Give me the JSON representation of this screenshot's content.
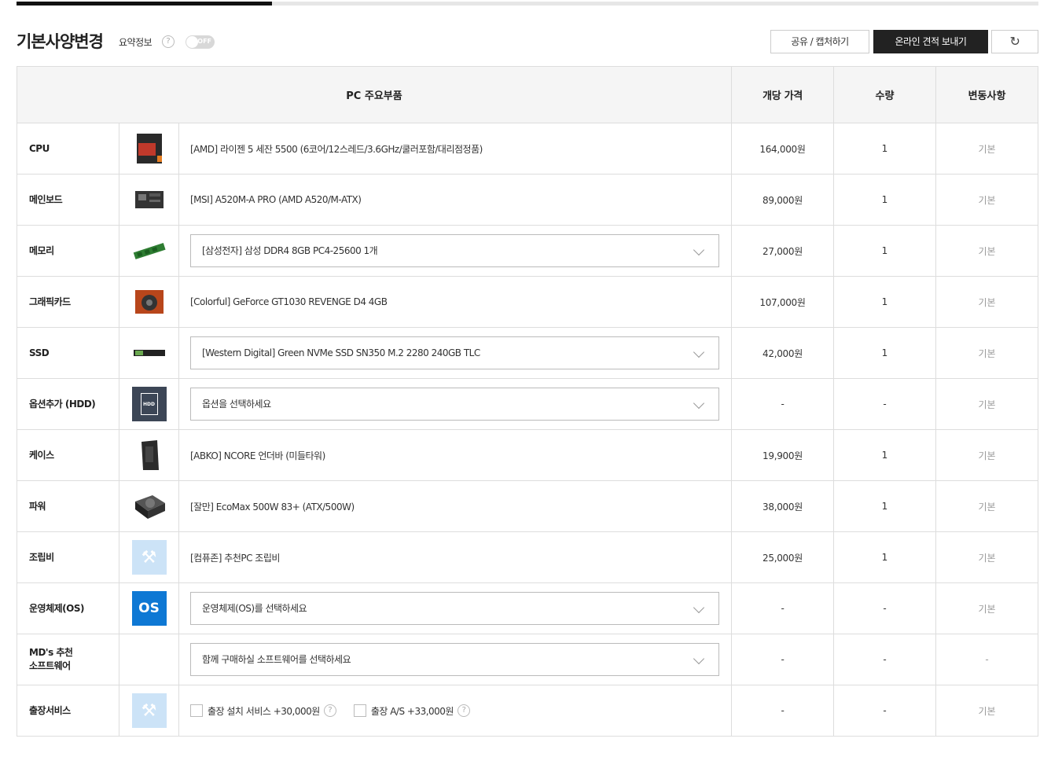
{
  "progress": {
    "fill_fraction": 0.25
  },
  "header": {
    "title": "기본사양변경",
    "summary_label": "요약정보",
    "summary_toggle_state": "OFF",
    "share_button": "공유 / 캡처하기",
    "send_button": "온라인 견적 보내기",
    "refresh_icon": "↻"
  },
  "table": {
    "headers": {
      "main": "PC 주요부품",
      "price": "개당 가격",
      "qty": "수량",
      "change": "변동사항"
    },
    "rows": [
      {
        "name": "CPU",
        "image": "cpu-box-icon",
        "desc": "[AMD] 라이젠 5 세잔 5500 (6코어/12스레드/3.6GHz/쿨러포함/대리점정품)",
        "price": "164,000원",
        "qty": "1",
        "change": "기본"
      },
      {
        "name": "메인보드",
        "image": "mainboard-icon",
        "desc": "[MSI] A520M-A PRO (AMD A520/M-ATX)",
        "price": "89,000원",
        "qty": "1",
        "change": "기본"
      },
      {
        "name": "메모리",
        "image": "memory-stick-icon",
        "select": "[삼성전자] 삼성 DDR4 8GB PC4-25600 1개",
        "price": "27,000원",
        "qty": "1",
        "change": "기본"
      },
      {
        "name": "그래픽카드",
        "image": "graphics-card-icon",
        "desc": "[Colorful] GeForce GT1030 REVENGE D4 4GB",
        "price": "107,000원",
        "qty": "1",
        "change": "기본"
      },
      {
        "name": "SSD",
        "image": "ssd-icon",
        "select": "[Western Digital] Green NVMe SSD SN350 M.2 2280 240GB TLC",
        "price": "42,000원",
        "qty": "1",
        "change": "기본"
      },
      {
        "name": "옵션추가 (HDD)",
        "image": "hdd-icon",
        "image_text": "HDD",
        "select": "옵션을 선택하세요",
        "price": "-",
        "qty": "-",
        "change": "기본"
      },
      {
        "name": "케이스",
        "image": "pc-case-icon",
        "desc": "[ABKO] NCORE 언더바 (미들타워)",
        "price": "19,900원",
        "qty": "1",
        "change": "기본"
      },
      {
        "name": "파워",
        "image": "power-supply-icon",
        "desc": "[잘만] EcoMax 500W 83+ (ATX/500W)",
        "price": "38,000원",
        "qty": "1",
        "change": "기본"
      },
      {
        "name": "조립비",
        "image": "assembly-tools-icon",
        "desc": "[컴퓨존] 추천PC 조립비",
        "price": "25,000원",
        "qty": "1",
        "change": "기본"
      },
      {
        "name": "운영체제(OS)",
        "image": "os-icon",
        "image_text": "OS",
        "select": "운영체제(OS)를 선택하세요",
        "price": "-",
        "qty": "-",
        "change": "기본"
      },
      {
        "name": "MD's 추천 소프트웨어",
        "name_line1": "MD's 추천",
        "name_line2": "소프트웨어",
        "image": "windows-logo-icon",
        "select": "함께 구매하실 소프트웨어를 선택하세요",
        "price": "-",
        "qty": "-",
        "change": "-"
      },
      {
        "name": "출장서비스",
        "image": "service-tools-icon",
        "checkboxes": [
          "출장 설치 서비스 +30,000원",
          "출장 A/S +33,000원"
        ],
        "price": "-",
        "qty": "-",
        "change": "기본"
      }
    ]
  },
  "colors": {
    "accent_dark": "#222222",
    "os_blue": "#0e78d4",
    "tool_bg": "#cce3f7",
    "hdd_bg": "#3c4656"
  }
}
